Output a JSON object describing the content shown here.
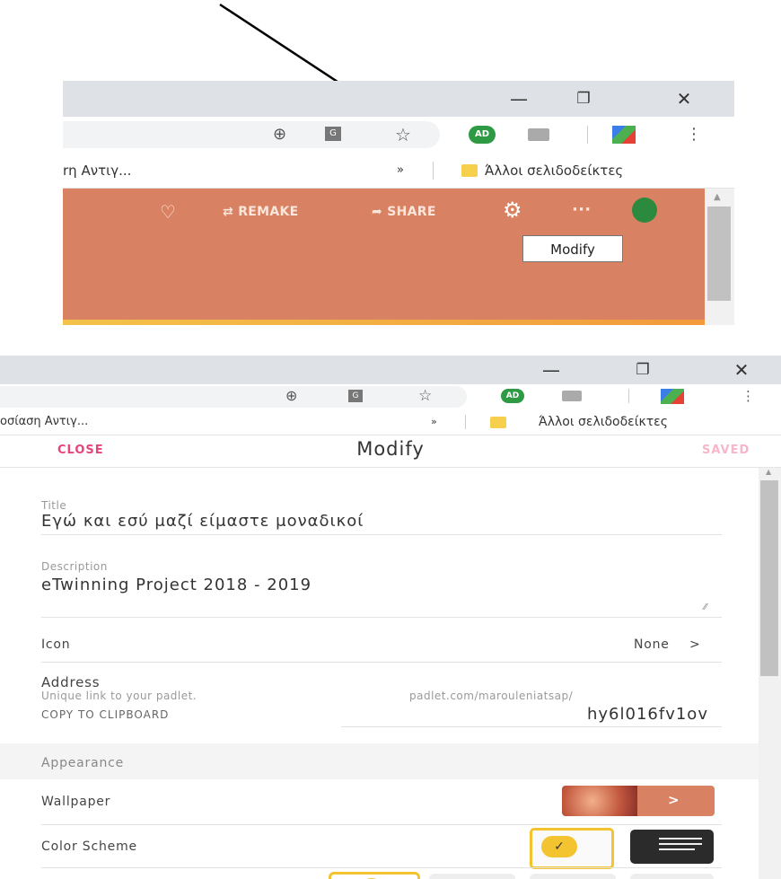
{
  "top": {
    "window_controls": {
      "minimize": "—",
      "restore": "❐",
      "close": "✕"
    },
    "toolbar_icons": {
      "add": "⊕",
      "translate": "G",
      "star": "☆",
      "avatar": "AD",
      "more": "⋮"
    },
    "bookmarks": {
      "left_text": "rη Αντιγ...",
      "chevron": "»",
      "other_label": "Άλλοι σελιδοδείκτες"
    },
    "padlet_actions": {
      "heart": "♡",
      "remake": "REMAKE",
      "share": "SHARE",
      "gear": "⚙",
      "more": "···"
    },
    "tooltip": "Modify"
  },
  "bottom": {
    "window_controls": {
      "minimize": "—",
      "restore": "❐",
      "close": "✕"
    },
    "toolbar_icons": {
      "add": "⊕",
      "translate": "G",
      "star": "☆",
      "avatar": "AD",
      "more": "⋮"
    },
    "bookmarks": {
      "left_text": "οσίαση Αντιγ...",
      "chevron": "»",
      "other_label": "Άλλοι σελιδοδείκτες"
    },
    "modal": {
      "close": "CLOSE",
      "title": "Modify",
      "saved": "SAVED"
    },
    "form": {
      "title_label": "Title",
      "title_value": "Εγώ και εσύ μαζί είμαστε μοναδικοί",
      "description_label": "Description",
      "description_value": "eTwinning Project 2018 - 2019",
      "icon_label": "Icon",
      "icon_value": "None",
      "icon_chevron": ">",
      "address_label": "Address",
      "address_help": "Unique link to your padlet.",
      "copy_label": "COPY TO CLIPBOARD",
      "address_domain": "padlet.com/marouleniatsap/",
      "address_slug": "hy6l016fv1ov",
      "appearance_label": "Appearance",
      "wallpaper_label": "Wallpaper",
      "wallpaper_chevron": ">",
      "color_scheme_label": "Color Scheme",
      "check": "✓"
    }
  },
  "colors": {
    "padlet_orange": "#d98263",
    "close_pink": "#e8447a",
    "saved_pink": "#f7b6c9",
    "scheme_yellow": "#f4c430"
  }
}
